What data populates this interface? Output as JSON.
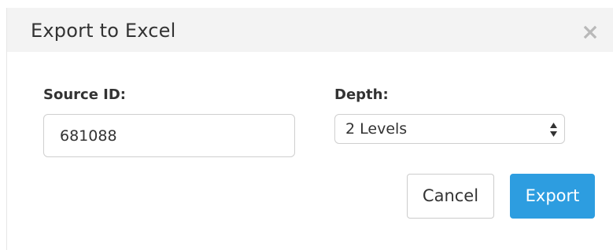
{
  "dialog": {
    "title": "Export to Excel",
    "close_icon": "close-icon"
  },
  "form": {
    "source_id": {
      "label": "Source ID:",
      "value": "681088"
    },
    "depth": {
      "label": "Depth:",
      "selected": "2 Levels",
      "icon": "select-arrows-icon"
    }
  },
  "buttons": {
    "cancel_label": "Cancel",
    "export_label": "Export"
  },
  "colors": {
    "header_bg": "#f3f3f3",
    "primary": "#2d9de0",
    "text": "#333333"
  }
}
